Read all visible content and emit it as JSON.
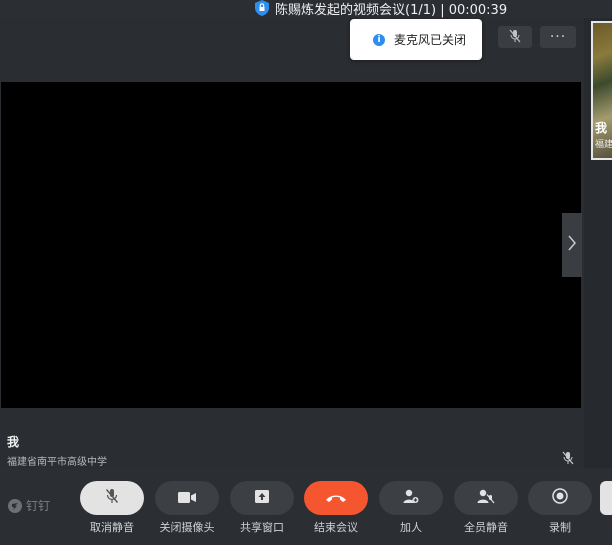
{
  "window": {
    "title": "陈赐炼发起的视频会议(1/1) | 00:00:39"
  },
  "toast": {
    "message": "麦克风已关闭",
    "icon": "info-icon"
  },
  "stage": {
    "top_controls": {
      "mic_icon": "mic-muted-icon",
      "more_label": "···"
    }
  },
  "participant": {
    "name": "我",
    "org": "福建省南平市高级中学"
  },
  "sidebar": {
    "thumbnail": {
      "name": "我",
      "org": "福建省南平市高级中学"
    }
  },
  "brand": {
    "label": "钉钉"
  },
  "toolbar": {
    "buttons": [
      {
        "label": "取消静音",
        "icon": "mic-muted-icon"
      },
      {
        "label": "关闭摄像头",
        "icon": "camera-icon"
      },
      {
        "label": "共享窗口",
        "icon": "share-window-icon"
      },
      {
        "label": "结束会议",
        "icon": "hangup-icon"
      },
      {
        "label": "加人",
        "icon": "add-person-icon"
      },
      {
        "label": "全员静音",
        "icon": "mute-all-icon"
      },
      {
        "label": "录制",
        "icon": "record-icon"
      }
    ]
  },
  "colors": {
    "end_call": "#f5552f",
    "toast_info": "#2e8ef0",
    "background": "#2b2e33"
  }
}
